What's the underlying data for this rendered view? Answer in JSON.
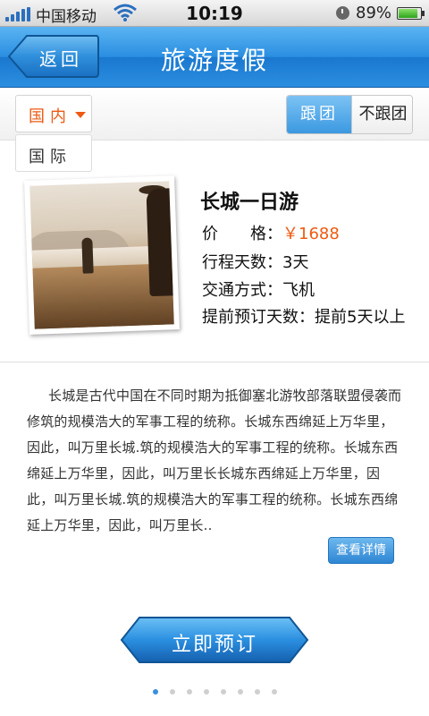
{
  "status_bar": {
    "carrier": "中国移动",
    "time": "10:19",
    "battery_pct": "89%",
    "battery_level": 0.89,
    "icons": [
      "signal-icon",
      "wifi-icon",
      "clock-icon",
      "battery-icon"
    ]
  },
  "nav": {
    "back_label": "返回",
    "title": "旅游度假"
  },
  "filter": {
    "region_selected": "国内",
    "region_options": [
      "国际"
    ],
    "tour_type": [
      "跟团",
      "不跟团"
    ],
    "tour_type_active": "跟团"
  },
  "product": {
    "name": "长城一日游",
    "price_label": "价　　格：",
    "price_value": "￥1688",
    "days_label": "行程天数：",
    "days_value": "3天",
    "transport_label": "交通方式：",
    "transport_value": "飞机",
    "advance_label": "提前预订天数：",
    "advance_value": "提前5天以上",
    "description": "长城是古代中国在不同时期为抵御塞北游牧部落联盟侵袭而修筑的规模浩大的军事工程的统称。长城东西绵延上万华里，因此，叫万里长城.筑的规模浩大的军事工程的统称。长城东西绵延上万华里，因此，叫万里长长城东西绵延上万华里，因此，叫万里长城.筑的规模浩大的军事工程的统称。长城东西绵延上万华里，因此，叫万里长.."
  },
  "actions": {
    "detail_label": "查看详情",
    "book_label": "立即预订"
  },
  "pager": {
    "count": 8,
    "active_index": 0
  },
  "colors": {
    "accent_blue": "#2a8ee0",
    "price_orange": "#ee5a12"
  }
}
